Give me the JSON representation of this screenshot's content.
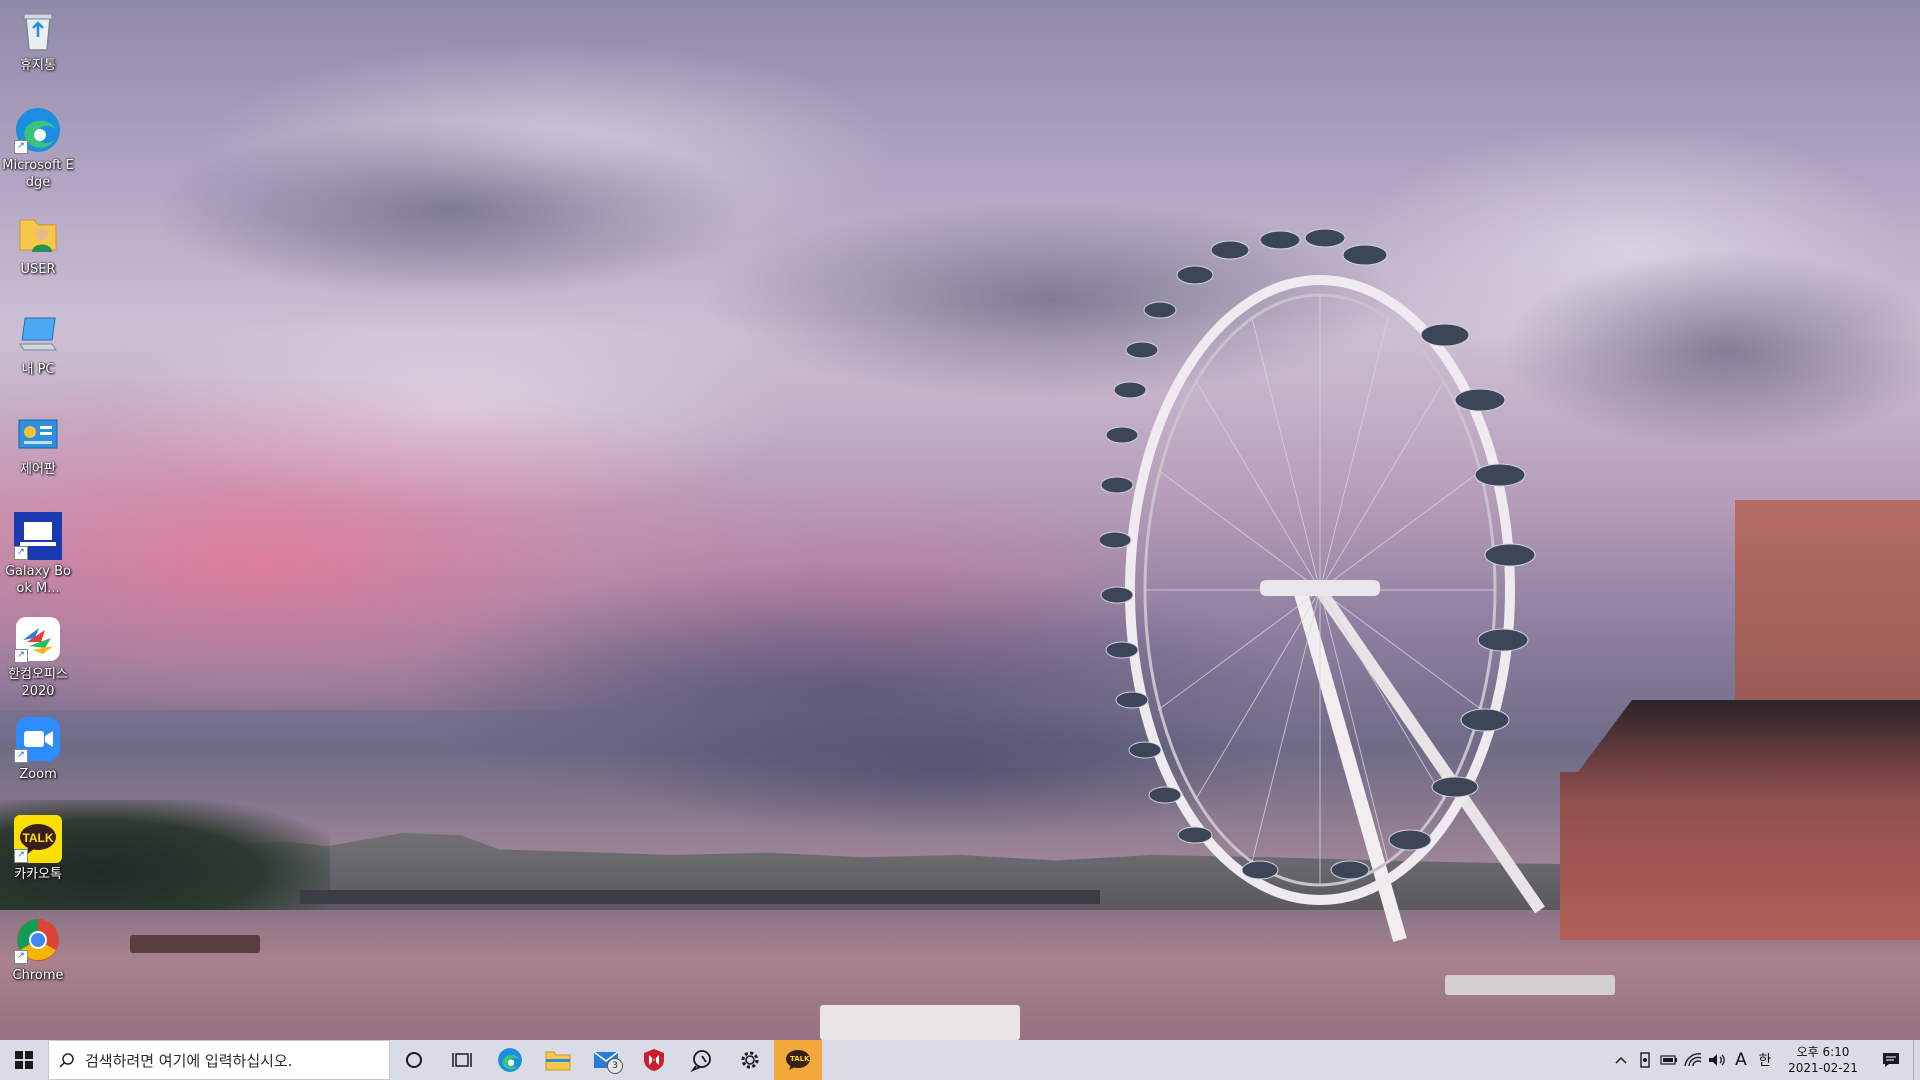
{
  "desktop": {
    "wallpaper": "London Eye at dusk",
    "icons": [
      {
        "name": "recycle-bin",
        "label": "휴지통",
        "icon": "recycle-bin-icon"
      },
      {
        "name": "microsoft-edge",
        "label": "Microsoft Edge",
        "icon": "edge-icon"
      },
      {
        "name": "user-folder",
        "label": "USER",
        "icon": "user-folder-icon"
      },
      {
        "name": "this-pc",
        "label": "내 PC",
        "icon": "pc-icon"
      },
      {
        "name": "control-panel",
        "label": "제어판",
        "icon": "control-panel-icon"
      },
      {
        "name": "galaxy-book",
        "label": "Galaxy Book M...",
        "icon": "galaxy-book-icon"
      },
      {
        "name": "hancom-office",
        "label": "한컴오피스 2020",
        "icon": "hancom-icon"
      },
      {
        "name": "zoom",
        "label": "Zoom",
        "icon": "zoom-icon"
      },
      {
        "name": "kakaotalk",
        "label": "카카오톡",
        "icon": "kakaotalk-icon"
      },
      {
        "name": "chrome",
        "label": "Chrome",
        "icon": "chrome-icon"
      }
    ]
  },
  "taskbar": {
    "search_placeholder": "검색하려면 여기에 입력하십시오.",
    "mail_badge": "3",
    "kakao_label": "TALK",
    "accent_color": "#f2a93a",
    "tray": {
      "ime_mode": "A",
      "ime_lang": "한",
      "time": "오후 6:10",
      "date": "2021-02-21"
    }
  }
}
